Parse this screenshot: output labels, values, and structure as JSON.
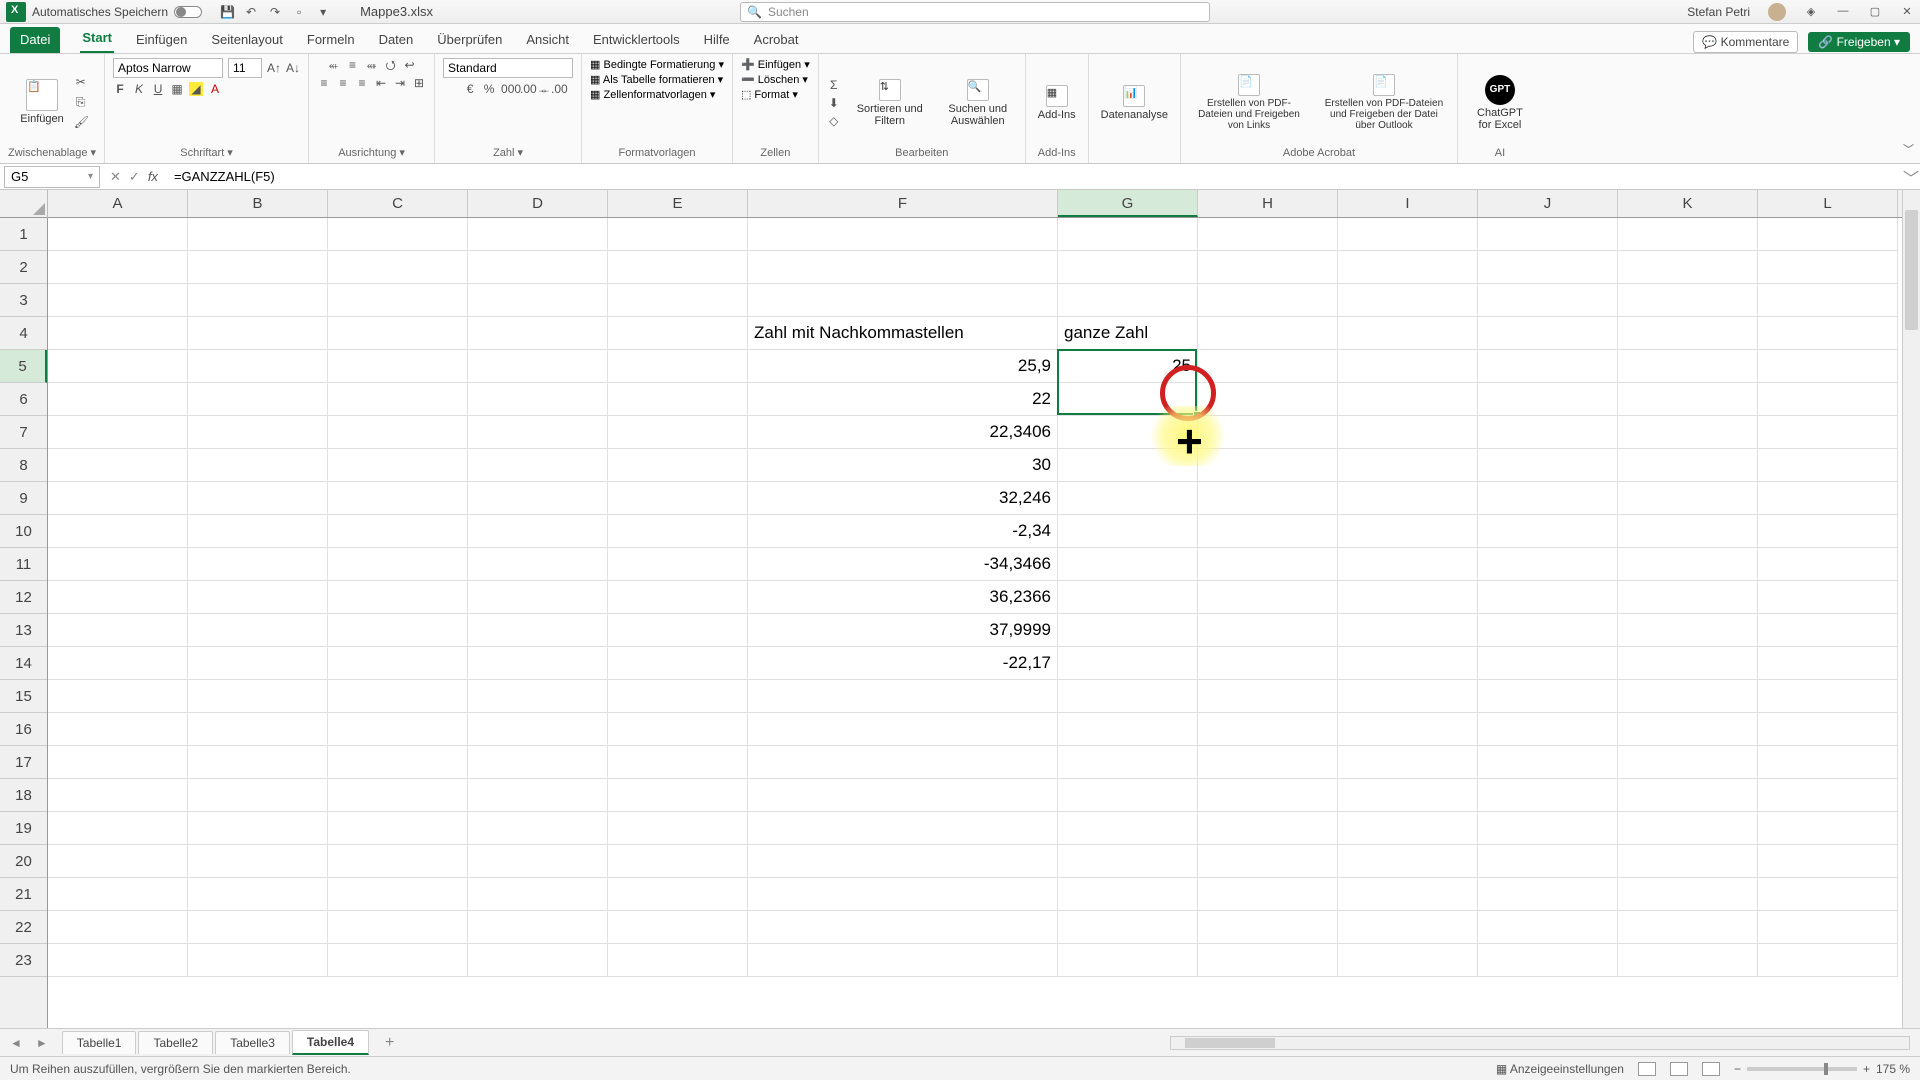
{
  "titlebar": {
    "autosave": "Automatisches Speichern",
    "filename": "Mappe3.xlsx",
    "search_placeholder": "Suchen",
    "user": "Stefan Petri"
  },
  "menu": {
    "file": "Datei",
    "tabs": [
      "Start",
      "Einfügen",
      "Seitenlayout",
      "Formeln",
      "Daten",
      "Überprüfen",
      "Ansicht",
      "Entwicklertools",
      "Hilfe",
      "Acrobat"
    ],
    "active": "Start",
    "comments": "Kommentare",
    "share": "Freigeben"
  },
  "ribbon": {
    "clipboard": {
      "paste": "Einfügen",
      "label": "Zwischenablage"
    },
    "font": {
      "name": "Aptos Narrow",
      "size": "11",
      "label": "Schriftart"
    },
    "align": {
      "label": "Ausrichtung"
    },
    "number": {
      "format": "Standard",
      "label": "Zahl"
    },
    "styles": {
      "cond": "Bedingte Formatierung",
      "table": "Als Tabelle formatieren",
      "cell": "Zellenformatvorlagen",
      "label": "Formatvorlagen"
    },
    "cells": {
      "insert": "Einfügen",
      "delete": "Löschen",
      "format": "Format",
      "label": "Zellen"
    },
    "editing": {
      "sort": "Sortieren und Filtern",
      "find": "Suchen und Auswählen",
      "label": "Bearbeiten"
    },
    "addins": {
      "btn": "Add-Ins",
      "label": "Add-Ins"
    },
    "analysis": {
      "btn": "Datenanalyse"
    },
    "acrobat": {
      "btn1": "Erstellen von PDF-Dateien und Freigeben von Links",
      "btn2": "Erstellen von PDF-Dateien und Freigeben der Datei über Outlook",
      "label": "Adobe Acrobat"
    },
    "ai": {
      "btn": "ChatGPT for Excel",
      "label": "AI"
    }
  },
  "fbar": {
    "cellref": "G5",
    "formula": "=GANZZAHL(F5)"
  },
  "cols": [
    "A",
    "B",
    "C",
    "D",
    "E",
    "F",
    "G",
    "H",
    "I",
    "J",
    "K",
    "L"
  ],
  "selectedCol": "G",
  "rowcount": 23,
  "selectedRow": 5,
  "data": {
    "F4": "Zahl mit Nachkommastellen",
    "G4": "ganze Zahl",
    "F5": "25,9",
    "G5": "25",
    "F6": "22",
    "F7": "22,3406",
    "F8": "30",
    "F9": "32,246",
    "F10": "-2,34",
    "F11": "-34,3466",
    "F12": "36,2366",
    "F13": "37,9999",
    "F14": "-22,17"
  },
  "selection": {
    "colStart": "G",
    "rowStart": 5,
    "rowEnd": 6
  },
  "sheets": {
    "tabs": [
      "Tabelle1",
      "Tabelle2",
      "Tabelle3",
      "Tabelle4"
    ],
    "active": "Tabelle4"
  },
  "status": {
    "msg": "Um Reihen auszufüllen, vergrößern Sie den markierten Bereich.",
    "settings": "Anzeigeeinstellungen",
    "zoom": "175 %"
  }
}
